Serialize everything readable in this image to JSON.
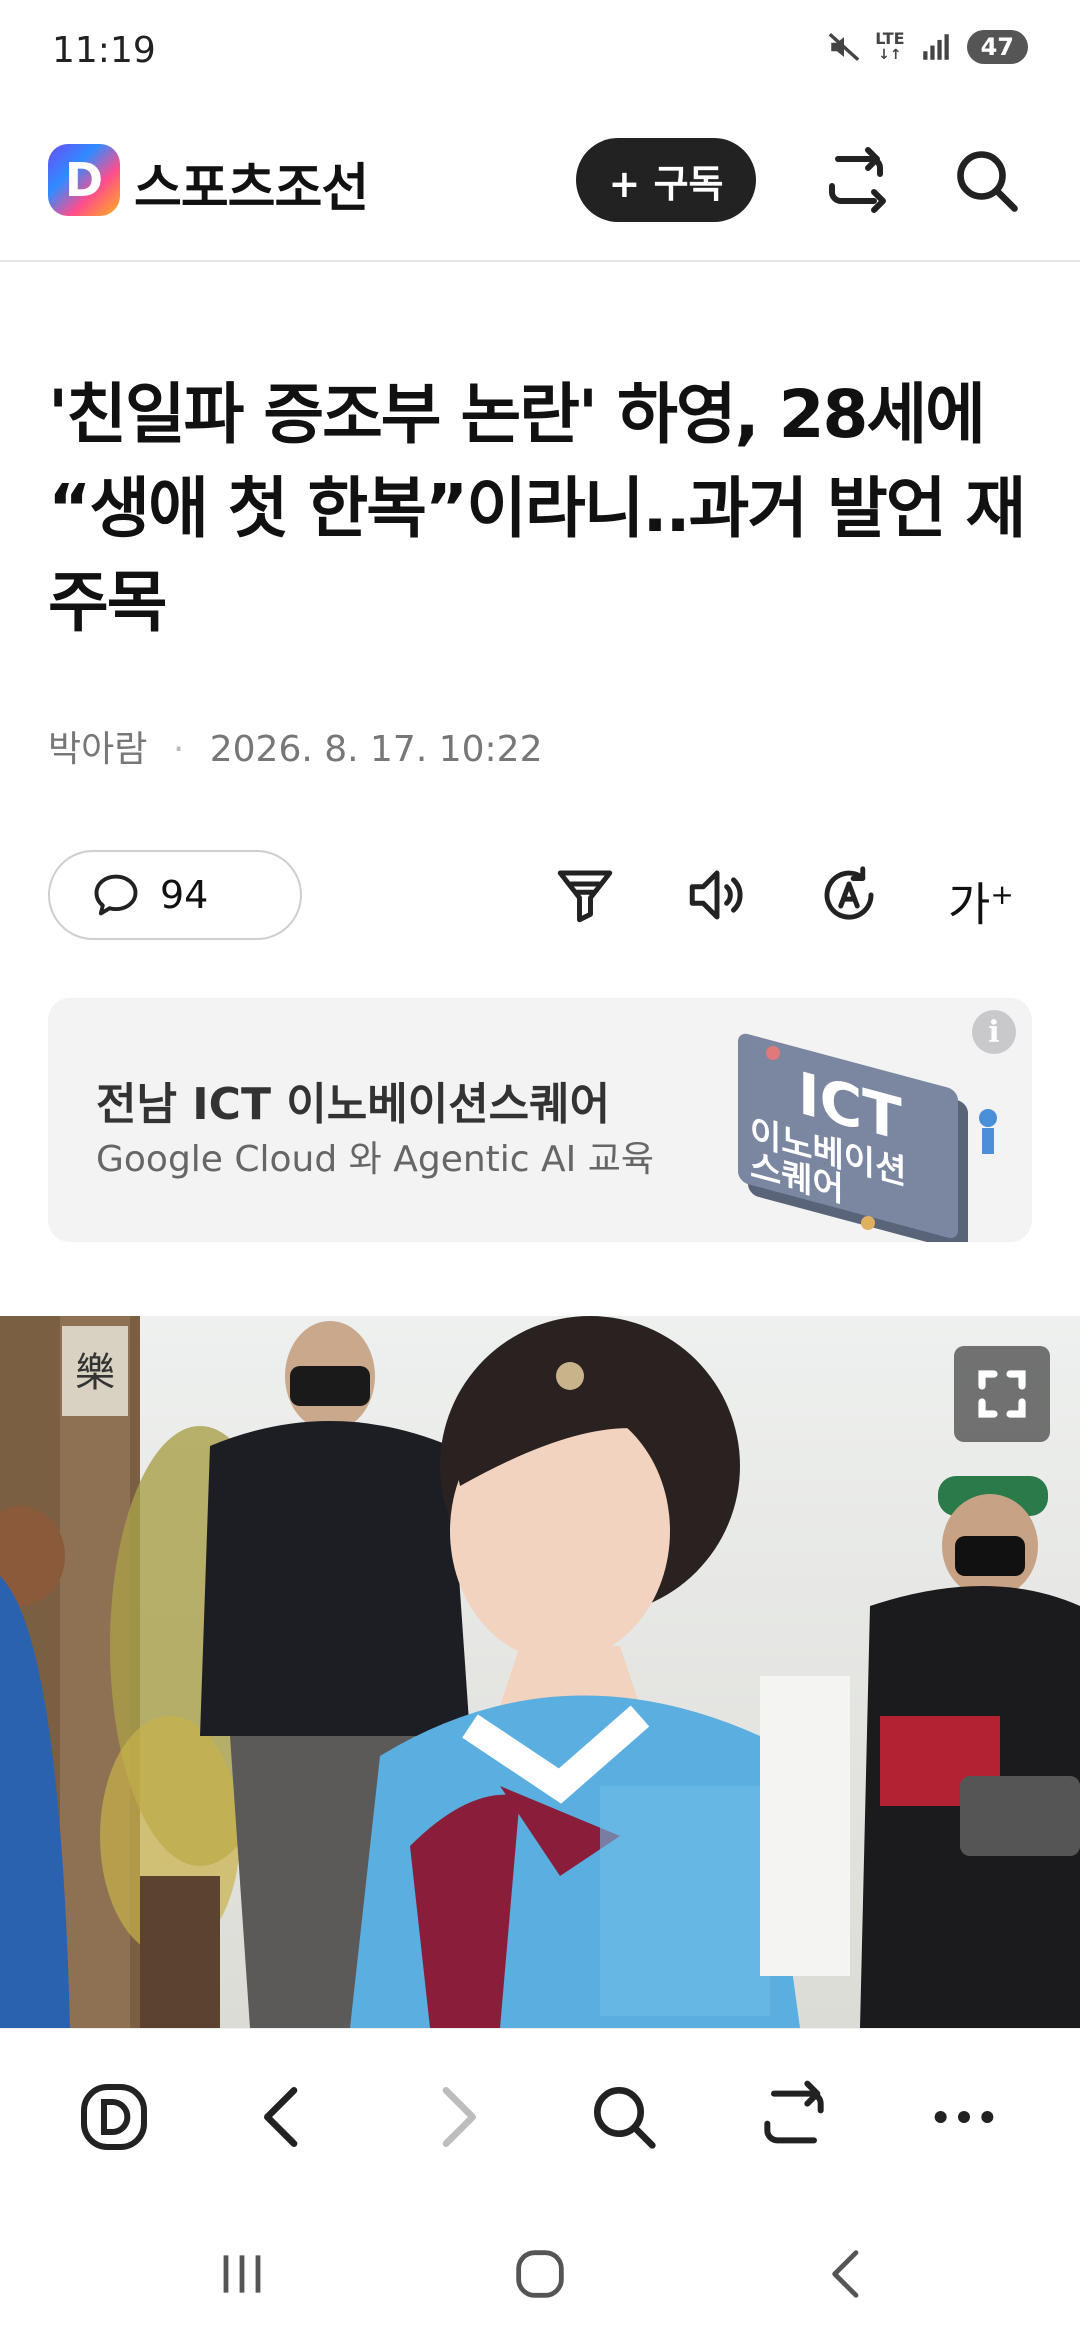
{
  "status_bar": {
    "time": "11:19",
    "network": "LTE",
    "battery": "47"
  },
  "header": {
    "logo_letter": "D",
    "brand": "스포츠조선",
    "subscribe_label": "+ 구독",
    "icons": [
      "share-icon",
      "search-icon"
    ]
  },
  "article": {
    "headline": "'친일파 증조부 논란' 하영, 28세에 “생애 첫 한복”이라니..과거 발언 재주목",
    "author": "박아람",
    "datetime": "2026. 8. 17. 10:22",
    "comment_count": "94",
    "tools": [
      "filter-icon",
      "listen-icon",
      "translate-icon",
      "font-size-icon"
    ],
    "font_size_label": "가"
  },
  "ad": {
    "title": "전남 ICT 이노베이션스퀘어",
    "subtitle": "Google Cloud 와 Agentic AI 교육",
    "art_text_1": "ICT",
    "art_text_2": "이노베이션",
    "art_text_3": "스퀘어",
    "info_label": "i"
  },
  "photo": {
    "sign_char": "樂"
  },
  "bottom_nav": [
    "home-d-icon",
    "back-icon",
    "forward-icon",
    "search-icon",
    "share-icon",
    "more-icon"
  ],
  "system_nav": [
    "recents-icon",
    "home-icon",
    "back-icon"
  ],
  "colors": {
    "subscribe_bg": "#222222",
    "accent_gradient": [
      "#6a4df5",
      "#2f8cff",
      "#ff4d8d",
      "#ffb21a"
    ],
    "hanbok": "#5aaee0"
  }
}
